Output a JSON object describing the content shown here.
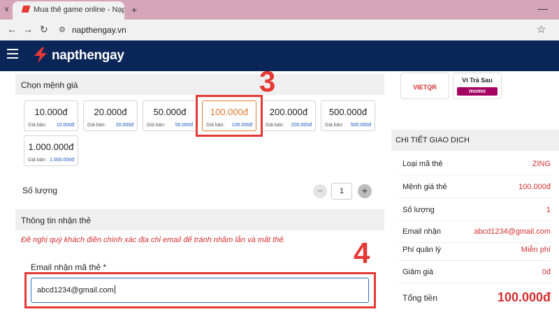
{
  "browser": {
    "tab_title": "Mua thẻ game online - Nạp tiề",
    "url": "napthengay.vn"
  },
  "site": {
    "logo": "napthengay"
  },
  "denomination": {
    "heading": "Chọn mệnh giá",
    "price_label": "Giá bán:",
    "options": [
      {
        "value": "10.000đ",
        "price": "10.000đ"
      },
      {
        "value": "20.000đ",
        "price": "20.000đ"
      },
      {
        "value": "50.000đ",
        "price": "50.000đ"
      },
      {
        "value": "100.000đ",
        "price": "100.000đ"
      },
      {
        "value": "200.000đ",
        "price": "200.000đ"
      },
      {
        "value": "500.000đ",
        "price": "500.000đ"
      },
      {
        "value": "1.000.000đ",
        "price": "1.000.000đ"
      }
    ],
    "selected_index": 3
  },
  "quantity": {
    "label": "Số lượng",
    "value": "1",
    "minus": "−",
    "plus": "+"
  },
  "recipient": {
    "heading": "Thông tin nhận thẻ",
    "notice": "Đề nghị quý khách điền chính xác địa chỉ email để tránh nhầm lẫn và mất thẻ.",
    "email_label": "Email nhận mã thẻ *",
    "email_value": "abcd1234@gmail.com"
  },
  "annotations": {
    "step3": "3",
    "step4": "4"
  },
  "payment": {
    "vietqr": "VIETQR",
    "momo_top": "Ví Trả Sau",
    "momo_bottom": "momo"
  },
  "details": {
    "heading": "CHI TIẾT GIAO DỊCH",
    "rows": [
      {
        "k": "Loại mã thẻ",
        "v": "ZING"
      },
      {
        "k": "Mệnh giá thẻ",
        "v": "100.000đ"
      },
      {
        "k": "Số lượng",
        "v": "1"
      },
      {
        "k": "Email nhận",
        "v": "abcd1234@gmail.com"
      },
      {
        "k": "Phí quản lý",
        "v": "Miễn phí"
      },
      {
        "k": "Giảm giá",
        "v": "0đ"
      }
    ],
    "total_label": "Tổng tiền",
    "total_value": "100.000đ"
  },
  "colors": {
    "header_bg": "#0a2558",
    "accent_red": "#e53935",
    "selected_orange": "#e07a2e",
    "price_blue": "#1a56c4"
  }
}
